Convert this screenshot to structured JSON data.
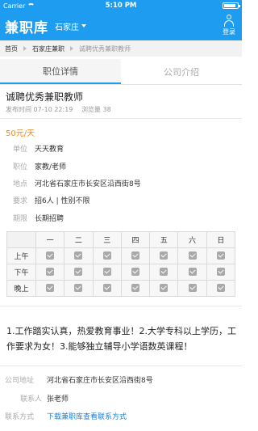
{
  "status_bar": {
    "carrier": "Carrier",
    "time": "5:10 PM"
  },
  "navbar": {
    "title": "兼职库",
    "city": "石家庄",
    "login_label": "登录"
  },
  "breadcrumb": [
    "首页",
    "石家庄兼职",
    "诚聘优秀兼职教师"
  ],
  "tabs": [
    {
      "label": "职位详情",
      "active": true
    },
    {
      "label": "公司介绍",
      "active": false
    }
  ],
  "job": {
    "title": "诚聘优秀兼职教师",
    "publish_time": "发布时间 07-10 22:19",
    "views": "浏览量 38",
    "salary": "50元/天",
    "fields": [
      {
        "label": "单位",
        "value": "天天教育"
      },
      {
        "label": "职位",
        "value": "家教/老师"
      },
      {
        "label": "地点",
        "value": "河北省石家庄市长安区沿西街8号"
      },
      {
        "label": "要求",
        "value": "招6人 | 性别不限"
      },
      {
        "label": "期限",
        "value": "长期招聘"
      }
    ]
  },
  "schedule": {
    "days": [
      "一",
      "二",
      "三",
      "四",
      "五",
      "六",
      "日"
    ],
    "rows": [
      {
        "label": "上午",
        "checked": [
          true,
          true,
          true,
          true,
          true,
          true,
          true
        ]
      },
      {
        "label": "下午",
        "checked": [
          true,
          true,
          true,
          true,
          true,
          true,
          true
        ]
      },
      {
        "label": "晚上",
        "checked": [
          true,
          true,
          true,
          true,
          true,
          true,
          true
        ]
      }
    ]
  },
  "description": "1.工作踏实认真，热爱教育事业！2.大学专科以上学历，工作要求为女！3.能够独立辅导小学语数英课程！",
  "company": {
    "address_label": "公司地址",
    "address": "河北省石家庄市长安区沿西街8号",
    "contact_label": "联系人",
    "contact": "张老师",
    "contact_method_label": "联系方式",
    "contact_method": "下载兼职库查看联系方式"
  },
  "colors": {
    "brand": "#1e9df0",
    "salary": "#f08c1a",
    "link": "#1e7fd6"
  },
  "icons": [
    "wifi-icon",
    "battery-icon",
    "user-icon",
    "chevron-down-icon",
    "chevron-right-icon",
    "checkbox-checked-icon"
  ]
}
